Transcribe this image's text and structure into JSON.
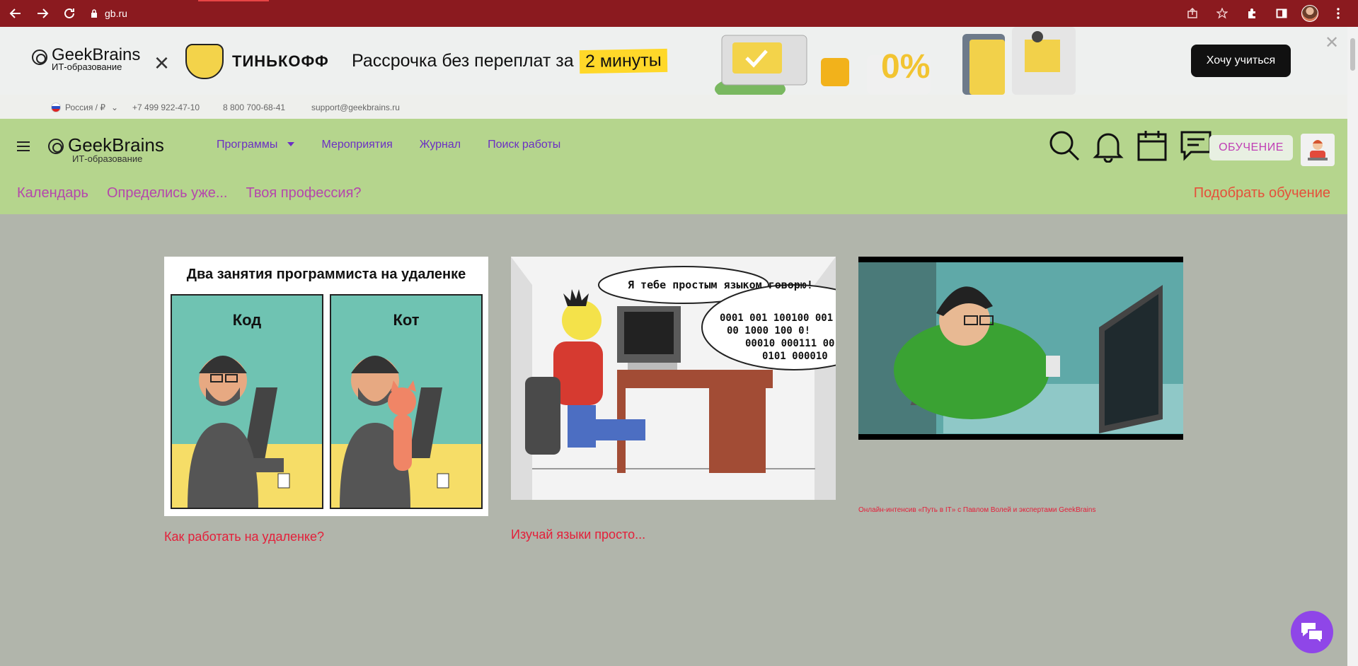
{
  "browser": {
    "url": "gb.ru"
  },
  "promo": {
    "gb_title": "GeekBrains",
    "gb_subtitle": "ИТ-образование",
    "partner": "ТИНЬКОФФ",
    "text": "Рассрочка без переплат за",
    "highlight": "2 минуты",
    "cta": "Хочу учиться",
    "close": "✕"
  },
  "contact": {
    "region": "Россия / ₽",
    "phone1": "+7 499 922-47-10",
    "phone2": "8 800 700-68-41",
    "email": "support@geekbrains.ru"
  },
  "header": {
    "logo_title": "GeekBrains",
    "logo_subtitle": "ИТ-образование",
    "nav": [
      {
        "label": "Программы"
      },
      {
        "label": "Мероприятия"
      },
      {
        "label": "Журнал"
      },
      {
        "label": "Поиск работы"
      }
    ],
    "study_button": "ОБУЧЕНИЕ",
    "subnav": [
      {
        "label": "Календарь"
      },
      {
        "label": "Определись уже..."
      },
      {
        "label": "Твоя профессия?"
      }
    ],
    "pick_link": "Подобрать обучение"
  },
  "cards": [
    {
      "comic_title": "Два занятия программиста на удаленке",
      "left_panel": "Код",
      "right_panel": "Кот",
      "caption": "Как работать на удаленке?"
    },
    {
      "speech": "Я тебе простым языком говорю!",
      "binary": [
        "0001 001 100100 001",
        "00 1000 100 0!",
        "00010 000111 00",
        "0101 000010"
      ],
      "caption": "Изучай языки просто..."
    },
    {
      "caption": "Онлайн-интенсив «Путь в IT» с Павлом Волей и экспертами GeekBrains"
    }
  ],
  "colors": {
    "browser_bar": "#8b1a1f",
    "header_bg": "#b5d58d",
    "page_bg": "#b1b5ab",
    "nav_purple": "#6b2fc4",
    "subnav_pink": "#b546ac",
    "caption_red": "#e3203a",
    "chat_purple": "#8f46e8"
  }
}
